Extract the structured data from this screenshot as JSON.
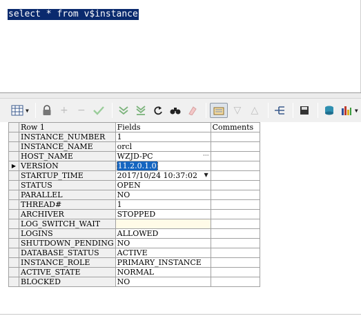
{
  "editor": {
    "sql": "select * from v$instance"
  },
  "toolbar": {
    "buttons": [
      {
        "name": "grid-view-icon"
      },
      {
        "name": "lock-icon"
      },
      {
        "name": "add-record-icon"
      },
      {
        "name": "delete-record-icon"
      },
      {
        "name": "post-changes-icon"
      },
      {
        "name": "fetch-next-icon"
      },
      {
        "name": "fetch-last-icon"
      },
      {
        "name": "refresh-icon"
      },
      {
        "name": "find-icon"
      },
      {
        "name": "clear-icon"
      },
      {
        "name": "single-record-view-icon"
      },
      {
        "name": "sort-descending-icon"
      },
      {
        "name": "sort-ascending-icon"
      },
      {
        "name": "tree-view-icon"
      },
      {
        "name": "save-icon"
      },
      {
        "name": "export-icon"
      },
      {
        "name": "chart-icon"
      }
    ]
  },
  "grid": {
    "headers": {
      "row": "Row 1",
      "fields": "Fields",
      "comments": "Comments"
    },
    "rows": [
      {
        "name": "INSTANCE_NUMBER",
        "value": "1"
      },
      {
        "name": "INSTANCE_NAME",
        "value": "orcl"
      },
      {
        "name": "HOST_NAME",
        "value": "WZJD-PC"
      },
      {
        "name": "VERSION",
        "value": "11.2.0.1.0"
      },
      {
        "name": "STARTUP_TIME",
        "value": "2017/10/24 10:37:02"
      },
      {
        "name": "STATUS",
        "value": "OPEN"
      },
      {
        "name": "PARALLEL",
        "value": "NO"
      },
      {
        "name": "THREAD#",
        "value": "1"
      },
      {
        "name": "ARCHIVER",
        "value": "STOPPED"
      },
      {
        "name": "LOG_SWITCH_WAIT",
        "value": ""
      },
      {
        "name": "LOGINS",
        "value": "ALLOWED"
      },
      {
        "name": "SHUTDOWN_PENDING",
        "value": "NO"
      },
      {
        "name": "DATABASE_STATUS",
        "value": "ACTIVE"
      },
      {
        "name": "INSTANCE_ROLE",
        "value": "PRIMARY_INSTANCE"
      },
      {
        "name": "ACTIVE_STATE",
        "value": "NORMAL"
      },
      {
        "name": "BLOCKED",
        "value": "NO"
      }
    ],
    "current_row_marker": "▶"
  }
}
